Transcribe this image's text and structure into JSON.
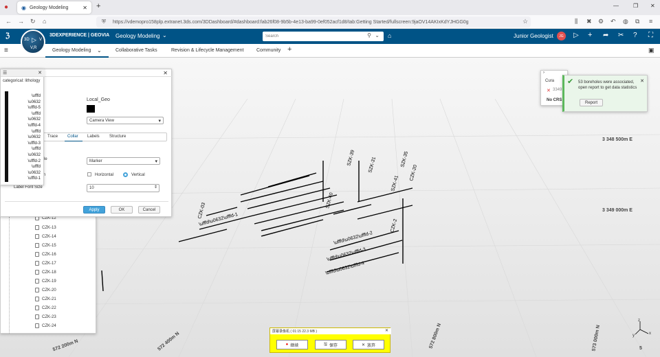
{
  "browser": {
    "tab_title": "Geology Modeling",
    "url": "https://vdemopro158plp.extranet.3ds.com/3DDashboard/#dashboard:fab26f08-9b5b-4e13-ba99-0ef052acf1d8/tab:Getting Started/fullscreen:9jaOV14AKIxKdYJHGG0g",
    "new_tab": "+"
  },
  "header": {
    "brand": "3DEXPERIENCE | GEOVIA",
    "app": "Geology Modeling",
    "search_placeholder": "Search",
    "user": "Junior Geologist",
    "user_badge": "JG",
    "compass_labels": {
      "top": "3D",
      "right": "V",
      "bottom": "V,R"
    }
  },
  "app_tabs": [
    {
      "label": "Geology Modeling"
    },
    {
      "label": "Collaborative Tasks"
    },
    {
      "label": "Revision & Lifecycle Management"
    },
    {
      "label": "Community"
    }
  ],
  "legend": {
    "title": "categorical: lithology",
    "entries": [
      "\\ufffd",
      "\\u0632",
      "\\ufffd-5",
      "\\ufffd",
      "\\u0632",
      "\\ufffd-4",
      "\\ufffd",
      "\\u0632",
      "\\ufffd-3",
      "\\ufffd",
      "\\u0632",
      "\\ufffd-2",
      "\\ufffd",
      "\\u0632",
      "\\ufffd-1"
    ]
  },
  "dialog": {
    "label_local": "Local_Geo",
    "camera": "Camera View",
    "tabs": [
      "Trace",
      "Collar",
      "Labels",
      "Structure"
    ],
    "active_tab": "Collar",
    "style_partial": "yle",
    "marker": "Marker",
    "orientation_partial": "n",
    "horizontal": "Horizontal",
    "vertical": "Vertical",
    "label_font_size": "Label Font Size",
    "font_size": "10",
    "apply": "Apply",
    "ok": "OK",
    "cancel": "Cancel"
  },
  "tree": {
    "partial_top": "CZK-12",
    "items": [
      "CZK-13",
      "CZK-14",
      "CZK-15",
      "CZK-16",
      "CZK-17",
      "CZK-18",
      "CZK-19",
      "CZK-20",
      "CZK-21",
      "CZK-22",
      "CZK-23",
      "CZK-24"
    ]
  },
  "crs_panel": {
    "title": "Cura",
    "value": "3349",
    "no_crs": "No CRS"
  },
  "notification": {
    "message": "53 boreholes were associated, open report to get data statistics",
    "button": "Report"
  },
  "coords": {
    "e1": "3 348 500m E",
    "e2": "3 349 000m E",
    "n1": "572 200m N",
    "n2": "572 400m N",
    "n3": "572 800m N",
    "n4": "573 000m N",
    "n5": "5"
  },
  "axis": {
    "z": "z",
    "x": "x",
    "y": "y"
  },
  "recorder": {
    "title": "屏幕录像机 ( 01:15  22.3 MB )",
    "continue": "继续",
    "save": "保存",
    "discard": "放弃"
  },
  "borehole_labels": [
    "CZK-03",
    "SZK-40",
    "SZK-39",
    "SZK-31",
    "SZK-35",
    "CZK-20",
    "SZK-41",
    "CZK-2",
    "\\ufffd\\u0632\\ufffd-1",
    "\\ufffd\\u0632\\ufffd-2",
    "\\ufffd\\u0632\\ufffd-3",
    "\\ufffd\\u0632\\ufffd-4"
  ]
}
